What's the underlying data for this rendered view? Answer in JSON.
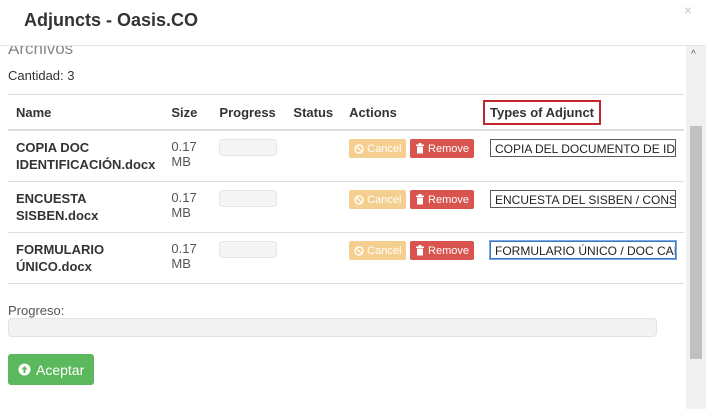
{
  "header": {
    "title": "Adjuncts - Oasis.CO",
    "close_label": "×"
  },
  "section": {
    "legend": "Archivos",
    "count": "Cantidad: 3"
  },
  "table": {
    "headers": [
      "Name",
      "Size",
      "Progress",
      "Status",
      "Actions",
      "Types of Adjunct"
    ],
    "rows": [
      {
        "name": "COPIA DOC IDENTIFICACIÓN.docx",
        "size": "0.17 MB",
        "status": "",
        "type": "COPIA DEL DOCUMENTO DE ID"
      },
      {
        "name": "ENCUESTA SISBEN.docx",
        "size": "0.17 MB",
        "status": "",
        "type": "ENCUESTA DEL SISBEN / CONS"
      },
      {
        "name": "FORMULARIO ÚNICO.docx",
        "size": "0.17 MB",
        "status": "",
        "type": "FORMULARIO ÚNICO / DOC CAI"
      }
    ],
    "actions": {
      "cancel": "Cancel",
      "remove": "Remove"
    }
  },
  "progress": {
    "label": "Progreso:",
    "value": 0
  },
  "footer": {
    "accept": "Aceptar"
  },
  "colors": {
    "accept": "#5cb85c",
    "remove": "#d9534f",
    "cancel": "#f5cf8f",
    "highlight": "#c0262d"
  },
  "icons": {
    "cancel": "ban-icon",
    "remove": "trash-icon",
    "accept": "arrow-up-circle-icon",
    "close": "close-icon"
  }
}
